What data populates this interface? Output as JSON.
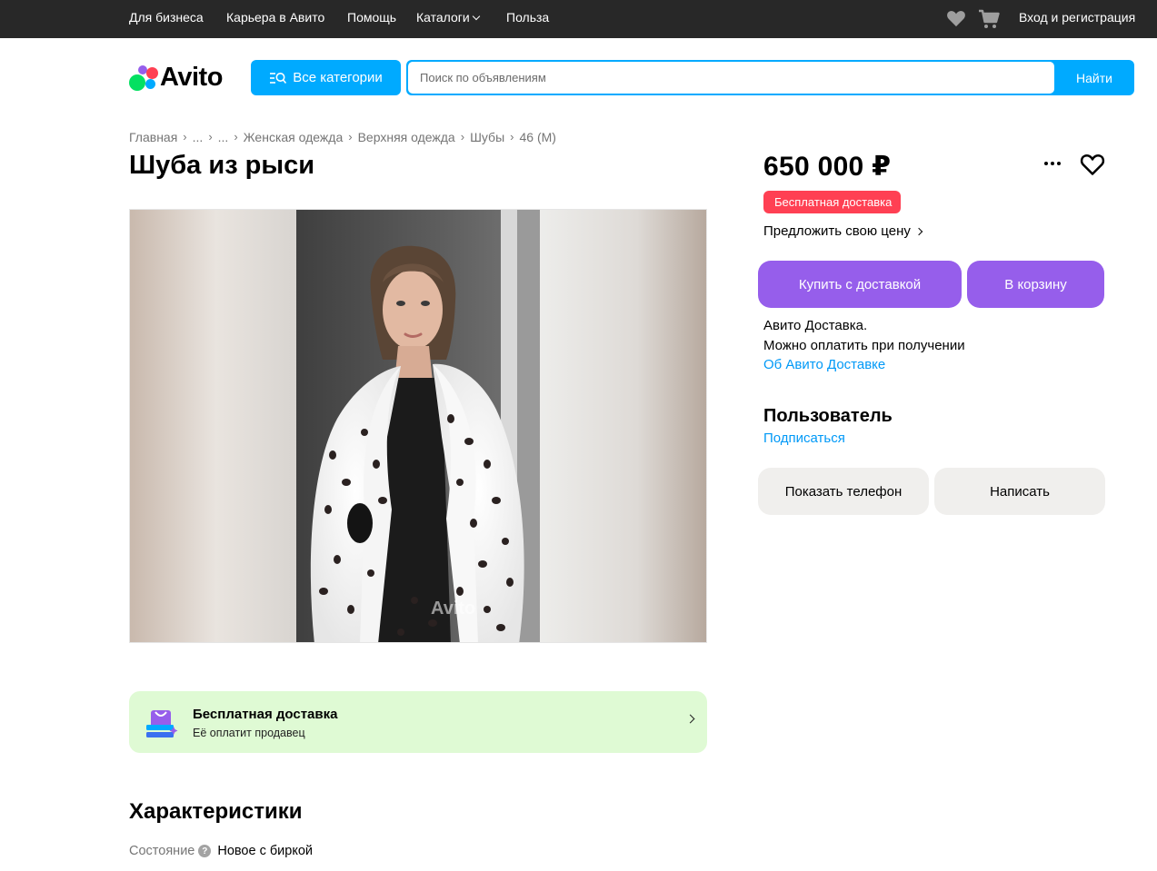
{
  "topbar": {
    "links": [
      "Для бизнеса",
      "Карьера в Авито",
      "Помощь",
      "Каталоги",
      "Польза"
    ],
    "login": "Вход и регистрация"
  },
  "header": {
    "logo_text": "Avito",
    "categories_label": "Все категории",
    "search_placeholder": "Поиск по объявлениям",
    "search_button": "Найти"
  },
  "breadcrumb": [
    "Главная",
    "...",
    "...",
    "Женская одежда",
    "Верхняя одежда",
    "Шубы",
    "46 (M)"
  ],
  "listing": {
    "title": "Шуба из рыси",
    "price": "650 000 ₽",
    "free_delivery_badge": "Бесплатная доставка",
    "offer_price": "Предложить свою цену",
    "buy_with_delivery": "Купить с доставкой",
    "add_to_cart": "В корзину",
    "delivery_info_1": "Авито Доставка.",
    "delivery_info_2": "Можно оплатить при получении",
    "delivery_link": "Об Авито Доставке"
  },
  "photo": {
    "watermark": "Avito"
  },
  "delivery_banner": {
    "title": "Бесплатная доставка",
    "subtitle": "Её оплатит продавец"
  },
  "seller": {
    "name": "Пользователь",
    "subscribe": "Подписаться",
    "show_phone": "Показать телефон",
    "write": "Написать"
  },
  "characteristics": {
    "title": "Характеристики",
    "rows": [
      {
        "label": "Состояние",
        "value": "Новое с биркой"
      }
    ]
  },
  "colors": {
    "topbar": "#282828",
    "accent_blue": "#00aaff",
    "purple": "#965eeb",
    "badge_red": "#ff4053",
    "link_blue": "#0099f7",
    "banner_green": "#dffad4"
  }
}
